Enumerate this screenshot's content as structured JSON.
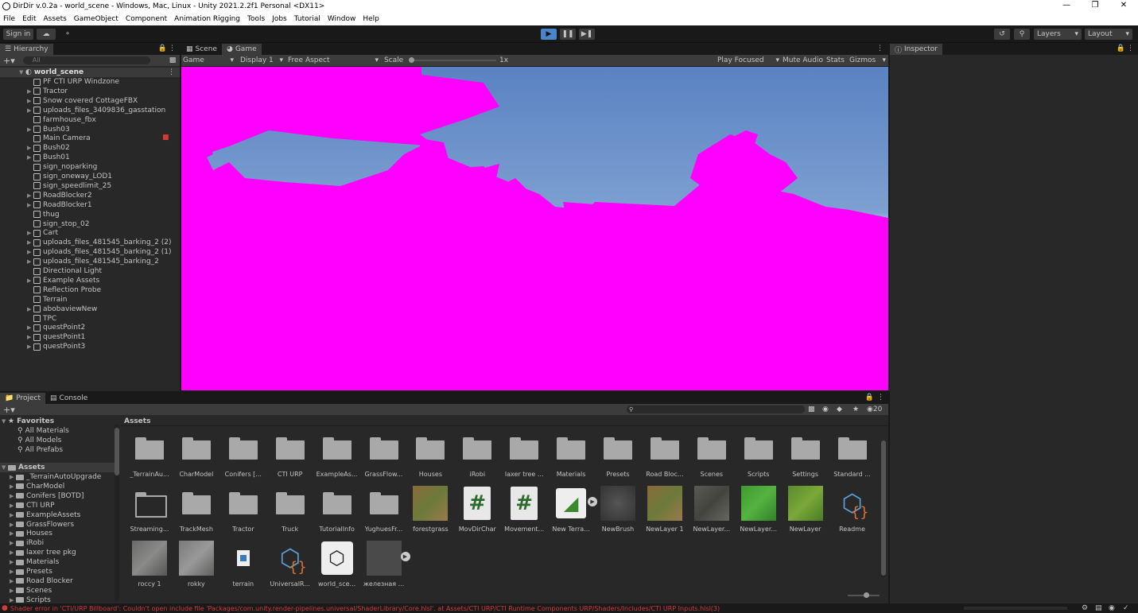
{
  "window": {
    "title": "DirDir v.0.2a - world_scene - Windows, Mac, Linux - Unity 2021.2.2f1 Personal <DX11>"
  },
  "menu": [
    "File",
    "Edit",
    "Assets",
    "GameObject",
    "Component",
    "Animation Rigging",
    "Tools",
    "Jobs",
    "Tutorial",
    "Window",
    "Help"
  ],
  "toolbar": {
    "sign_in": "Sign in",
    "layers": "Layers",
    "layout": "Layout"
  },
  "hierarchy": {
    "tab": "Hierarchy",
    "search_placeholder": "All",
    "scene": "world_scene",
    "items": [
      {
        "label": "PF CTI URP Windzone",
        "arrow": false
      },
      {
        "label": "Tractor",
        "arrow": true
      },
      {
        "label": "Snow covered CottageFBX",
        "arrow": true
      },
      {
        "label": "uploads_files_3409836_gasstation",
        "arrow": true
      },
      {
        "label": "farmhouse_fbx",
        "arrow": false
      },
      {
        "label": "Bush03",
        "arrow": true
      },
      {
        "label": "Main Camera",
        "arrow": false
      },
      {
        "label": "Bush02",
        "arrow": true
      },
      {
        "label": "Bush01",
        "arrow": true
      },
      {
        "label": "sign_noparking",
        "arrow": false
      },
      {
        "label": "sign_oneway_LOD1",
        "arrow": false
      },
      {
        "label": "sign_speedlimit_25",
        "arrow": false
      },
      {
        "label": "RoadBlocker2",
        "arrow": true
      },
      {
        "label": "RoadBlocker1",
        "arrow": true
      },
      {
        "label": "thug",
        "arrow": false
      },
      {
        "label": "sign_stop_02",
        "arrow": false
      },
      {
        "label": "Cart",
        "arrow": true
      },
      {
        "label": "uploads_files_481545_barking_2 (2)",
        "arrow": true
      },
      {
        "label": "uploads_files_481545_barking_2 (1)",
        "arrow": true
      },
      {
        "label": "uploads_files_481545_barking_2",
        "arrow": true
      },
      {
        "label": "Directional Light",
        "arrow": false
      },
      {
        "label": "Example Assets",
        "arrow": true
      },
      {
        "label": "Reflection Probe",
        "arrow": false
      },
      {
        "label": "Terrain",
        "arrow": false
      },
      {
        "label": "abobaviewNew",
        "arrow": true
      },
      {
        "label": "TPC",
        "arrow": false
      },
      {
        "label": "questPoint2",
        "arrow": true
      },
      {
        "label": "questPoint1",
        "arrow": true
      },
      {
        "label": "questPoint3",
        "arrow": true
      }
    ]
  },
  "scene_tabs": {
    "scene": "Scene",
    "game": "Game"
  },
  "game_bar": {
    "game": "Game",
    "display": "Display 1",
    "aspect": "Free Aspect",
    "scale_label": "Scale",
    "scale_value": "1x",
    "play_focused": "Play Focused",
    "mute": "Mute Audio",
    "stats": "Stats",
    "gizmos": "Gizmos"
  },
  "inspector": {
    "tab": "Inspector"
  },
  "project": {
    "tab_project": "Project",
    "tab_console": "Console",
    "badge": "20",
    "favorites": {
      "title": "Favorites",
      "items": [
        "All Materials",
        "All Models",
        "All Prefabs"
      ]
    },
    "assets_root": "Assets",
    "folders": [
      "_TerrainAutoUpgrade",
      "CharModel",
      "Conifers [BOTD]",
      "CTI URP",
      "ExampleAssets",
      "GrassFlowers",
      "Houses",
      "iRobi",
      "laxer tree pkg",
      "Materials",
      "Presets",
      "Road Blocker",
      "Scenes",
      "Scripts"
    ],
    "breadcrumb": "Assets",
    "grid": [
      {
        "label": "_TerrainAu...",
        "kind": "folder"
      },
      {
        "label": "CharModel",
        "kind": "folder"
      },
      {
        "label": "Conifers [...",
        "kind": "folder"
      },
      {
        "label": "CTI URP",
        "kind": "folder"
      },
      {
        "label": "ExampleAs...",
        "kind": "folder"
      },
      {
        "label": "GrassFlow...",
        "kind": "folder"
      },
      {
        "label": "Houses",
        "kind": "folder"
      },
      {
        "label": "iRobi",
        "kind": "folder"
      },
      {
        "label": "laxer tree ...",
        "kind": "folder"
      },
      {
        "label": "Materials",
        "kind": "folder"
      },
      {
        "label": "Presets",
        "kind": "folder"
      },
      {
        "label": "Road Bloc...",
        "kind": "folder"
      },
      {
        "label": "Scenes",
        "kind": "folder"
      },
      {
        "label": "Scripts",
        "kind": "folder"
      },
      {
        "label": "Settings",
        "kind": "folder"
      },
      {
        "label": "Standard ...",
        "kind": "folder"
      },
      {
        "label": "Streaming...",
        "kind": "folder-open"
      },
      {
        "label": "TrackMesh",
        "kind": "folder"
      },
      {
        "label": "Tractor",
        "kind": "folder"
      },
      {
        "label": "Truck",
        "kind": "folder"
      },
      {
        "label": "TutorialInfo",
        "kind": "folder"
      },
      {
        "label": "YughuesFr...",
        "kind": "folder"
      },
      {
        "label": "forestgrass",
        "kind": "tex-dirt"
      },
      {
        "label": "MovDirChar",
        "kind": "script"
      },
      {
        "label": "Movement...",
        "kind": "script"
      },
      {
        "label": "New Terra...",
        "kind": "terrain"
      },
      {
        "label": "NewBrush",
        "kind": "tex-dark"
      },
      {
        "label": "NewLayer 1",
        "kind": "tex-dirt"
      },
      {
        "label": "NewLayer...",
        "kind": "tex-gray"
      },
      {
        "label": "NewLayer...",
        "kind": "tex-green"
      },
      {
        "label": "NewLayer",
        "kind": "tex-green2"
      },
      {
        "label": "Readme",
        "kind": "readme"
      },
      {
        "label": "roccy 1",
        "kind": "tex-rock"
      },
      {
        "label": "rokky",
        "kind": "tex-rock2"
      },
      {
        "label": "terrain",
        "kind": "file"
      },
      {
        "label": "UniversalR...",
        "kind": "readme"
      },
      {
        "label": "world_sce...",
        "kind": "unity"
      },
      {
        "label": "железная ...",
        "kind": "prefab"
      }
    ]
  },
  "status": {
    "error": "Shader error in 'CTI/URP Billboard': Couldn't open include file 'Packages/com.unity.render-pipelines.universal/ShaderLibrary/Core.hlsl'. at Assets/CTI URP/CTI Runtime Components URP/Shaders/Includes/CTI URP Inputs.hlsl(3)"
  },
  "colors": {
    "magenta": "#ff00ff",
    "sky_top": "#5e86c4",
    "sky_bottom": "#c9d6e6",
    "error": "#d03b3b",
    "play_blue": "#4a85c9"
  }
}
